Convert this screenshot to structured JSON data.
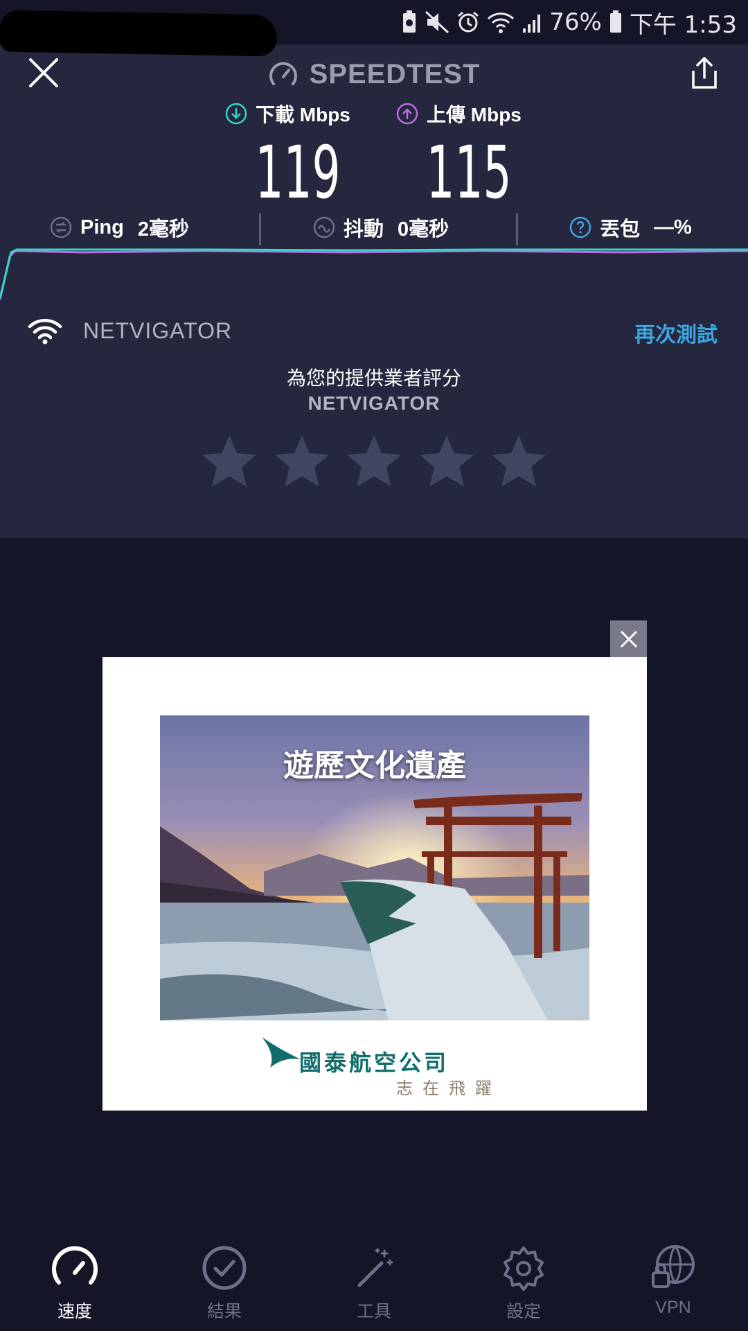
{
  "status_bar": {
    "battery": "76%",
    "time": "下午 1:53"
  },
  "header": {
    "title": "SPEEDTEST"
  },
  "metrics": {
    "download": {
      "label": "下載 Mbps",
      "value": "119",
      "color": "#33d6c9"
    },
    "upload": {
      "label": "上傳 Mbps",
      "value": "115",
      "color": "#bf6de3"
    }
  },
  "stats": {
    "ping": {
      "label": "Ping",
      "value": "2毫秒"
    },
    "jitter": {
      "label": "抖動",
      "value": "0毫秒"
    },
    "packet_loss": {
      "label": "丟包",
      "value": "—%"
    }
  },
  "provider": {
    "name": "NETVIGATOR",
    "retest": "再次測試",
    "rate_prompt": "為您的提供業者評分",
    "rate_name": "NETVIGATOR",
    "rating_stars": 5,
    "rating_value": 0
  },
  "ad": {
    "headline": "遊歷文化遺產",
    "brand": "國泰航空公司",
    "tagline": "志在飛躍"
  },
  "nav": {
    "items": [
      {
        "label": "速度",
        "icon": "speedometer-icon",
        "active": true
      },
      {
        "label": "結果",
        "icon": "check-circle-icon",
        "active": false
      },
      {
        "label": "工具",
        "icon": "magic-wand-icon",
        "active": false
      },
      {
        "label": "設定",
        "icon": "gear-icon",
        "active": false
      },
      {
        "label": "VPN",
        "icon": "vpn-globe-icon",
        "active": false
      }
    ]
  },
  "colors": {
    "accent": "#3ea6e0",
    "panel": "#24273d",
    "background": "#141628"
  }
}
